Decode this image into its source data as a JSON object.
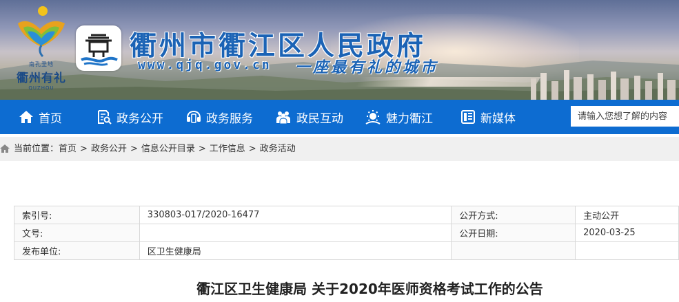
{
  "header": {
    "logo_tagline": "南孔圣地",
    "logo_name": "衢州有礼",
    "logo_pinyin": "QUZHOU",
    "site_title": "衢州市衢江区人民政府",
    "site_url": "www.qjq.gov.cn",
    "slogan": "一座最有礼的城市"
  },
  "nav": {
    "items": [
      {
        "label": "首页",
        "icon": "home-icon"
      },
      {
        "label": "政务公开",
        "icon": "document-search-icon"
      },
      {
        "label": "政务服务",
        "icon": "service-icon"
      },
      {
        "label": "政民互动",
        "icon": "people-icon"
      },
      {
        "label": "魅力衢江",
        "icon": "sun-icon"
      },
      {
        "label": "新媒体",
        "icon": "media-icon"
      }
    ],
    "search_placeholder": "请输入您想了解的内容"
  },
  "breadcrumb": {
    "prefix": "当前位置：",
    "items": [
      "首页",
      "政务公开",
      "信息公开目录",
      "工作信息",
      "政务活动"
    ],
    "separator": ">"
  },
  "info_table": {
    "rows": [
      {
        "label1": "索引号:",
        "value1": "330803-017/2020-16477",
        "label2": "公开方式:",
        "value2": "主动公开"
      },
      {
        "label1": "文号:",
        "value1": "",
        "label2": "公开日期:",
        "value2": "2020-03-25"
      },
      {
        "label1": "发布单位:",
        "value1": "区卫生健康局",
        "label2": "",
        "value2": ""
      }
    ]
  },
  "article": {
    "title": "衢江区卫生健康局 关于2020年医师资格考试工作的公告"
  },
  "colors": {
    "nav_bg": "#0d6cd1",
    "title_blue": "#1b63b5",
    "crumb_bg": "#f0f0f0"
  }
}
